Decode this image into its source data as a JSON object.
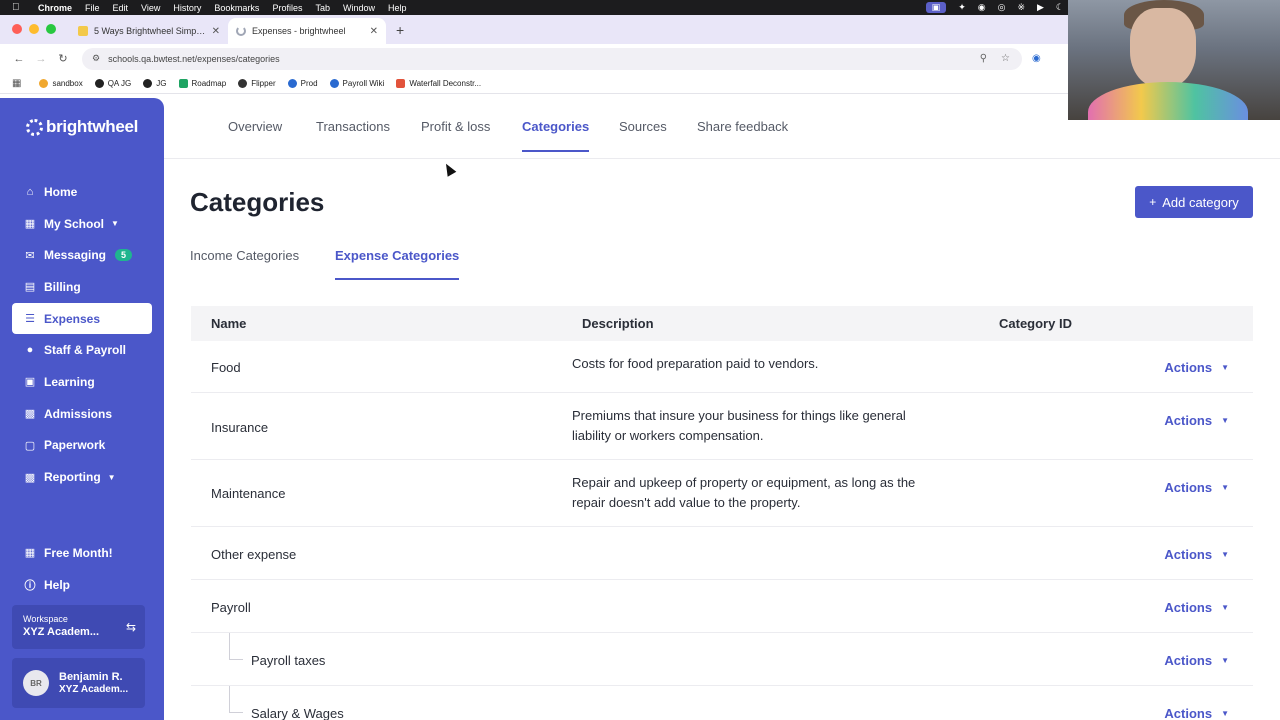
{
  "menubar": {
    "items": [
      "Chrome",
      "File",
      "Edit",
      "View",
      "History",
      "Bookmarks",
      "Profiles",
      "Tab",
      "Window",
      "Help"
    ]
  },
  "browser": {
    "tabs": [
      {
        "title": "5 Ways Brightwheel Simplifie",
        "active": false
      },
      {
        "title": "Expenses - brightwheel",
        "active": true
      }
    ],
    "url": "schools.qa.bwtest.net/expenses/categories",
    "bookmarks": [
      "sandbox",
      "QA JG",
      "JG",
      "Roadmap",
      "Flipper",
      "Prod",
      "Payroll Wiki",
      "Waterfall Deconstr..."
    ]
  },
  "sidebar": {
    "logo": "brightwheel",
    "items": [
      {
        "label": "Home",
        "icon": "home-icon"
      },
      {
        "label": "My School",
        "icon": "school-icon",
        "chevron": true
      },
      {
        "label": "Messaging",
        "icon": "message-icon",
        "badge": "5"
      },
      {
        "label": "Billing",
        "icon": "billing-icon"
      },
      {
        "label": "Expenses",
        "icon": "expenses-icon",
        "active": true
      },
      {
        "label": "Staff & Payroll",
        "icon": "staff-icon"
      },
      {
        "label": "Learning",
        "icon": "book-icon"
      },
      {
        "label": "Admissions",
        "icon": "admissions-icon"
      },
      {
        "label": "Paperwork",
        "icon": "paperwork-icon"
      },
      {
        "label": "Reporting",
        "icon": "chart-icon",
        "chevron": true
      }
    ],
    "bottom": [
      {
        "label": "Free Month!",
        "icon": "gift-icon"
      },
      {
        "label": "Help",
        "icon": "help-icon"
      }
    ],
    "workspace": {
      "label": "Workspace",
      "name": "XYZ Academ..."
    },
    "user": {
      "initials": "BR",
      "name": "Benjamin R.",
      "school": "XYZ Academ..."
    }
  },
  "topnav": [
    "Overview",
    "Transactions",
    "Profit & loss",
    "Categories",
    "Sources",
    "Share feedback"
  ],
  "page": {
    "title": "Categories",
    "add_button": "Add category",
    "subtabs": [
      "Income Categories",
      "Expense Categories"
    ]
  },
  "table": {
    "headers": {
      "name": "Name",
      "description": "Description",
      "id": "Category ID"
    },
    "action_label": "Actions",
    "rows": [
      {
        "name": "Food",
        "description": "Costs for food preparation paid to vendors."
      },
      {
        "name": "Insurance",
        "description": "Premiums that insure your business for things like general liability or workers compensation."
      },
      {
        "name": "Maintenance",
        "description": "Repair and upkeep of property or equipment, as long as the repair doesn't add value to the property."
      },
      {
        "name": "Other expense",
        "description": ""
      },
      {
        "name": "Payroll",
        "description": ""
      },
      {
        "name": "Payroll taxes",
        "description": ""
      },
      {
        "name": "Salary & Wages",
        "description": ""
      }
    ]
  }
}
